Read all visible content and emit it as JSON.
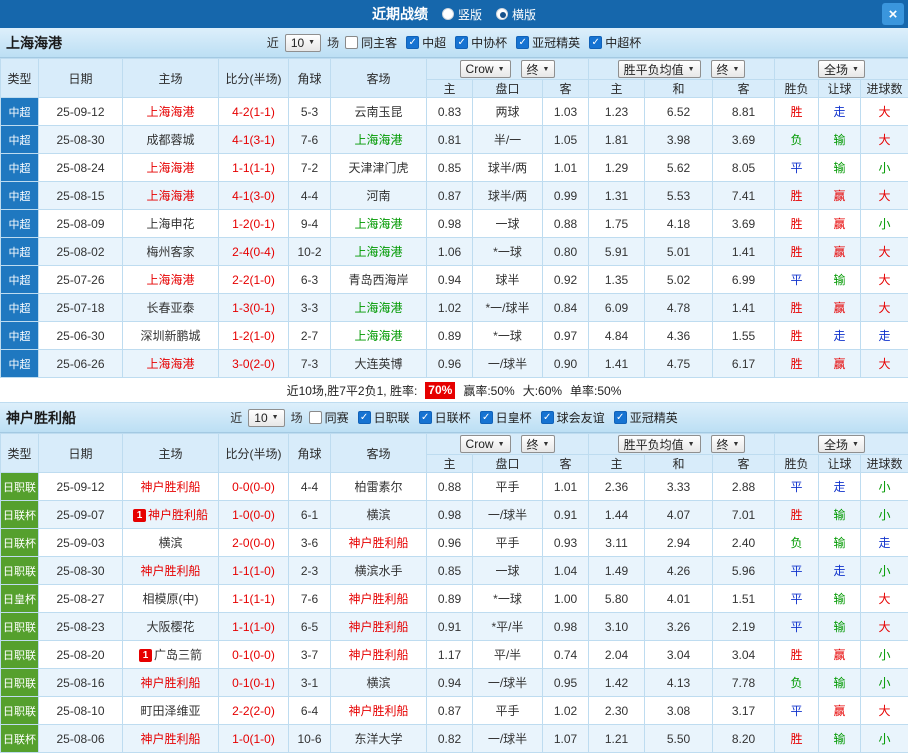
{
  "titlebar": {
    "title": "近期战绩",
    "radios": [
      {
        "label": "竖版",
        "selected": false
      },
      {
        "label": "横版",
        "selected": true
      }
    ],
    "close_icon": "×"
  },
  "filters_common": {
    "near": "近",
    "near_value": "10",
    "matches": "场"
  },
  "table_header": {
    "type": "类型",
    "date": "日期",
    "home": "主场",
    "score": "比分(半场)",
    "corner": "角球",
    "away": "客场",
    "odds_source": "Crow",
    "final": "终",
    "wdl_avg": "胜平负均值",
    "full": "全场",
    "sub": [
      "主",
      "盘口",
      "客",
      "主",
      "和",
      "客",
      "胜负",
      "让球",
      "进球数"
    ]
  },
  "colors": {
    "team_self": "#e60000",
    "team_away": "#009900",
    "team_default": "#333333",
    "win": "#e60000",
    "lose": "#009900",
    "push": "#1133cc",
    "score": "#e60000"
  },
  "sections": [
    {
      "team": "上海海港",
      "type_color": "#1f78c0",
      "checkboxes": [
        {
          "label": "同主客",
          "checked": false
        },
        {
          "label": "中超",
          "checked": true
        },
        {
          "label": "中协杯",
          "checked": true
        },
        {
          "label": "亚冠精英",
          "checked": true
        },
        {
          "label": "中超杯",
          "checked": true
        }
      ],
      "rows": [
        {
          "type": "中超",
          "date": "25-09-12",
          "home": "上海海港",
          "home_color": "red",
          "home_badge": "",
          "score": "4-2(1-1)",
          "corners": "5-3",
          "away": "云南玉昆",
          "away_color": "",
          "asian": [
            "0.83",
            "两球",
            "1.03"
          ],
          "europe": [
            "1.23",
            "6.52",
            "8.81"
          ],
          "results": [
            "胜",
            "走",
            "大"
          ]
        },
        {
          "type": "中超",
          "date": "25-08-30",
          "home": "成都蓉城",
          "home_color": "",
          "home_badge": "",
          "score": "4-1(3-1)",
          "corners": "7-6",
          "away": "上海海港",
          "away_color": "green",
          "asian": [
            "0.81",
            "半/一",
            "1.05"
          ],
          "europe": [
            "1.81",
            "3.98",
            "3.69"
          ],
          "results": [
            "负",
            "输",
            "大"
          ]
        },
        {
          "type": "中超",
          "date": "25-08-24",
          "home": "上海海港",
          "home_color": "red",
          "home_badge": "",
          "score": "1-1(1-1)",
          "corners": "7-2",
          "away": "天津津门虎",
          "away_color": "",
          "asian": [
            "0.85",
            "球半/两",
            "1.01"
          ],
          "europe": [
            "1.29",
            "5.62",
            "8.05"
          ],
          "results": [
            "平",
            "输",
            "小"
          ]
        },
        {
          "type": "中超",
          "date": "25-08-15",
          "home": "上海海港",
          "home_color": "red",
          "home_badge": "",
          "score": "4-1(3-0)",
          "corners": "4-4",
          "away": "河南",
          "away_color": "",
          "asian": [
            "0.87",
            "球半/两",
            "0.99"
          ],
          "europe": [
            "1.31",
            "5.53",
            "7.41"
          ],
          "results": [
            "胜",
            "赢",
            "大"
          ]
        },
        {
          "type": "中超",
          "date": "25-08-09",
          "home": "上海申花",
          "home_color": "",
          "home_badge": "",
          "score": "1-2(0-1)",
          "corners": "9-4",
          "away": "上海海港",
          "away_color": "green",
          "asian": [
            "0.98",
            "一球",
            "0.88"
          ],
          "europe": [
            "1.75",
            "4.18",
            "3.69"
          ],
          "results": [
            "胜",
            "赢",
            "小"
          ]
        },
        {
          "type": "中超",
          "date": "25-08-02",
          "home": "梅州客家",
          "home_color": "",
          "home_badge": "",
          "score": "2-4(0-4)",
          "corners": "10-2",
          "away": "上海海港",
          "away_color": "green",
          "asian": [
            "1.06",
            "*一球",
            "0.80"
          ],
          "europe": [
            "5.91",
            "5.01",
            "1.41"
          ],
          "results": [
            "胜",
            "赢",
            "大"
          ]
        },
        {
          "type": "中超",
          "date": "25-07-26",
          "home": "上海海港",
          "home_color": "red",
          "home_badge": "",
          "score": "2-2(1-0)",
          "corners": "6-3",
          "away": "青岛西海岸",
          "away_color": "",
          "asian": [
            "0.94",
            "球半",
            "0.92"
          ],
          "europe": [
            "1.35",
            "5.02",
            "6.99"
          ],
          "results": [
            "平",
            "输",
            "大"
          ]
        },
        {
          "type": "中超",
          "date": "25-07-18",
          "home": "长春亚泰",
          "home_color": "",
          "home_badge": "",
          "score": "1-3(0-1)",
          "corners": "3-3",
          "away": "上海海港",
          "away_color": "green",
          "asian": [
            "1.02",
            "*一/球半",
            "0.84"
          ],
          "europe": [
            "6.09",
            "4.78",
            "1.41"
          ],
          "results": [
            "胜",
            "赢",
            "大"
          ]
        },
        {
          "type": "中超",
          "date": "25-06-30",
          "home": "深圳新鹏城",
          "home_color": "",
          "home_badge": "",
          "score": "1-2(1-0)",
          "corners": "2-7",
          "away": "上海海港",
          "away_color": "green",
          "asian": [
            "0.89",
            "*一球",
            "0.97"
          ],
          "europe": [
            "4.84",
            "4.36",
            "1.55"
          ],
          "results": [
            "胜",
            "走",
            "走"
          ]
        },
        {
          "type": "中超",
          "date": "25-06-26",
          "home": "上海海港",
          "home_color": "red",
          "home_badge": "",
          "score": "3-0(2-0)",
          "corners": "7-3",
          "away": "大连英博",
          "away_color": "",
          "asian": [
            "0.96",
            "一/球半",
            "0.90"
          ],
          "europe": [
            "1.41",
            "4.75",
            "6.17"
          ],
          "results": [
            "胜",
            "赢",
            "大"
          ]
        }
      ],
      "footer": {
        "summary": "近10场,胜7平2负1, 胜率:",
        "win_rate": "70%",
        "stats": [
          "赢率:50%",
          "大:60%",
          "单率:50%"
        ]
      }
    },
    {
      "team": "神户胜利船",
      "type_color": "#55a02d",
      "checkboxes": [
        {
          "label": "同赛",
          "checked": false
        },
        {
          "label": "日职联",
          "checked": true
        },
        {
          "label": "日联杯",
          "checked": true
        },
        {
          "label": "日皇杯",
          "checked": true
        },
        {
          "label": "球会友谊",
          "checked": true
        },
        {
          "label": "亚冠精英",
          "checked": true
        }
      ],
      "rows": [
        {
          "type": "日职联",
          "date": "25-09-12",
          "home": "神户胜利船",
          "home_color": "red",
          "home_badge": "",
          "score": "0-0(0-0)",
          "corners": "4-4",
          "away": "柏雷素尔",
          "away_color": "",
          "asian": [
            "0.88",
            "平手",
            "1.01"
          ],
          "europe": [
            "2.36",
            "3.33",
            "2.88"
          ],
          "results": [
            "平",
            "走",
            "小"
          ]
        },
        {
          "type": "日联杯",
          "date": "25-09-07",
          "home": "神户胜利船",
          "home_color": "red",
          "home_badge": "1",
          "score": "1-0(0-0)",
          "corners": "6-1",
          "away": "横滨",
          "away_color": "",
          "asian": [
            "0.98",
            "一/球半",
            "0.91"
          ],
          "europe": [
            "1.44",
            "4.07",
            "7.01"
          ],
          "results": [
            "胜",
            "输",
            "小"
          ]
        },
        {
          "type": "日联杯",
          "date": "25-09-03",
          "home": "横滨",
          "home_color": "",
          "home_badge": "",
          "score": "2-0(0-0)",
          "corners": "3-6",
          "away": "神户胜利船",
          "away_color": "red",
          "asian": [
            "0.96",
            "平手",
            "0.93"
          ],
          "europe": [
            "3.11",
            "2.94",
            "2.40"
          ],
          "results": [
            "负",
            "输",
            "走"
          ]
        },
        {
          "type": "日职联",
          "date": "25-08-30",
          "home": "神户胜利船",
          "home_color": "red",
          "home_badge": "",
          "score": "1-1(1-0)",
          "corners": "2-3",
          "away": "横滨水手",
          "away_color": "",
          "asian": [
            "0.85",
            "一球",
            "1.04"
          ],
          "europe": [
            "1.49",
            "4.26",
            "5.96"
          ],
          "results": [
            "平",
            "走",
            "小"
          ]
        },
        {
          "type": "日皇杯",
          "date": "25-08-27",
          "home": "相模原(中)",
          "home_color": "",
          "home_badge": "",
          "score": "1-1(1-1)",
          "corners": "7-6",
          "away": "神户胜利船",
          "away_color": "red",
          "asian": [
            "0.89",
            "*一球",
            "1.00"
          ],
          "europe": [
            "5.80",
            "4.01",
            "1.51"
          ],
          "results": [
            "平",
            "输",
            "大"
          ]
        },
        {
          "type": "日职联",
          "date": "25-08-23",
          "home": "大阪樱花",
          "home_color": "",
          "home_badge": "",
          "score": "1-1(1-0)",
          "corners": "6-5",
          "away": "神户胜利船",
          "away_color": "red",
          "asian": [
            "0.91",
            "*平/半",
            "0.98"
          ],
          "europe": [
            "3.10",
            "3.26",
            "2.19"
          ],
          "results": [
            "平",
            "输",
            "大"
          ]
        },
        {
          "type": "日职联",
          "date": "25-08-20",
          "home": "广岛三箭",
          "home_color": "",
          "home_badge": "1",
          "score": "0-1(0-0)",
          "corners": "3-7",
          "away": "神户胜利船",
          "away_color": "red",
          "asian": [
            "1.17",
            "平/半",
            "0.74"
          ],
          "europe": [
            "2.04",
            "3.04",
            "3.04"
          ],
          "results": [
            "胜",
            "赢",
            "小"
          ]
        },
        {
          "type": "日职联",
          "date": "25-08-16",
          "home": "神户胜利船",
          "home_color": "red",
          "home_badge": "",
          "score": "0-1(0-1)",
          "corners": "3-1",
          "away": "横滨",
          "away_color": "",
          "asian": [
            "0.94",
            "一/球半",
            "0.95"
          ],
          "europe": [
            "1.42",
            "4.13",
            "7.78"
          ],
          "results": [
            "负",
            "输",
            "小"
          ]
        },
        {
          "type": "日职联",
          "date": "25-08-10",
          "home": "町田泽维亚",
          "home_color": "",
          "home_badge": "",
          "score": "2-2(2-0)",
          "corners": "6-4",
          "away": "神户胜利船",
          "away_color": "red",
          "asian": [
            "0.87",
            "平手",
            "1.02"
          ],
          "europe": [
            "2.30",
            "3.08",
            "3.17"
          ],
          "results": [
            "平",
            "赢",
            "大"
          ]
        },
        {
          "type": "日联杯",
          "date": "25-08-06",
          "home": "神户胜利船",
          "home_color": "red",
          "home_badge": "",
          "score": "1-0(1-0)",
          "corners": "10-6",
          "away": "东洋大学",
          "away_color": "",
          "asian": [
            "0.82",
            "一/球半",
            "1.07"
          ],
          "europe": [
            "1.21",
            "5.50",
            "8.20"
          ],
          "results": [
            "胜",
            "输",
            "小"
          ]
        }
      ]
    }
  ]
}
